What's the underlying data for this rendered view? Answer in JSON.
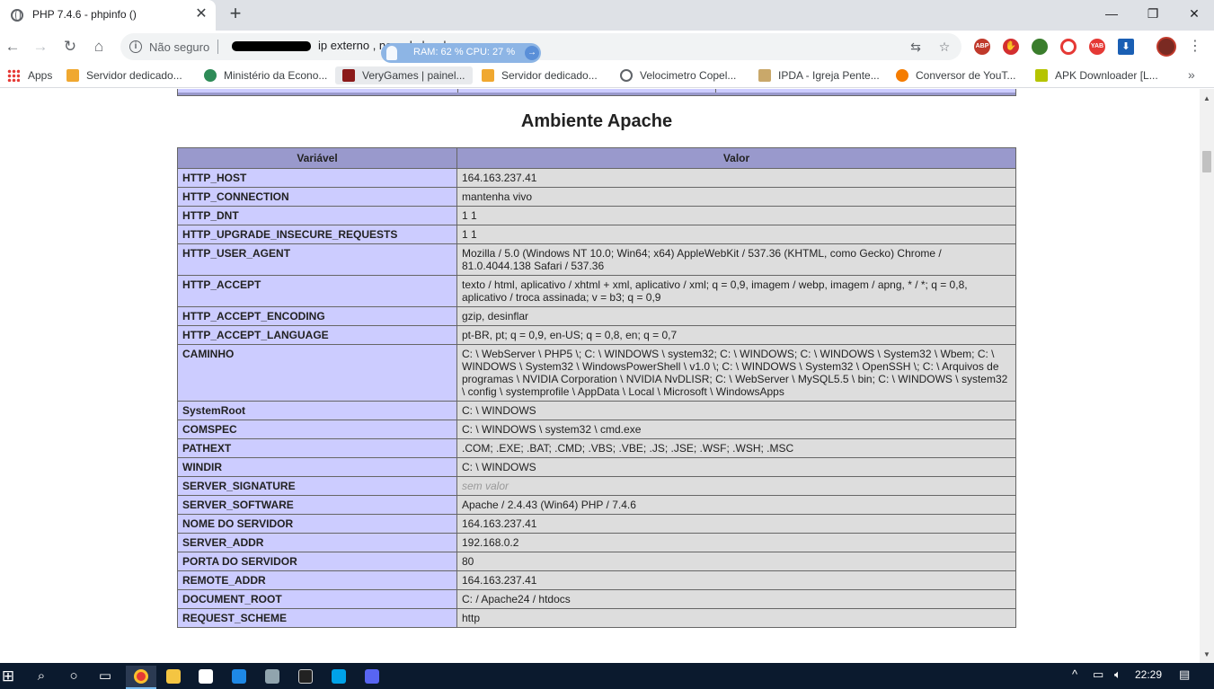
{
  "browser": {
    "tab_title": "PHP 7.4.6 - phpinfo ()",
    "tab_close": "✕",
    "new_tab": "+",
    "window_controls": {
      "minimize": "—",
      "maximize": "❐",
      "close": "✕"
    },
    "nav": {
      "back": "←",
      "forward": "→",
      "reload": "↻",
      "home": "⌂"
    },
    "omnibox": {
      "security_label": "Não seguro",
      "url_text": "ip externo , na rede local"
    },
    "ram_cpu": "RAM: 62 %  CPU: 27 %",
    "icons": {
      "translate": "translate-icon",
      "star": "star-icon",
      "ext_abp": "ABP",
      "ext_yab": "YAB",
      "menu": "⋮"
    },
    "bookmarks": [
      {
        "label": "Apps",
        "color": "#e53935",
        "icon": "apps-grid-icon"
      },
      {
        "label": "Servidor dedicado...",
        "color": "#f0a830",
        "icon": "server-icon"
      },
      {
        "label": "Ministério da Econo...",
        "color": "#2e8b57",
        "icon": "ministry-icon"
      },
      {
        "label": "VeryGames | painel...",
        "color": "#8b1a1a",
        "icon": "verygames-icon"
      },
      {
        "label": "Servidor dedicado...",
        "color": "#f0a830",
        "icon": "server-icon"
      },
      {
        "label": "Velocimetro Copel...",
        "color": "#5f6368",
        "icon": "globe-icon"
      },
      {
        "label": "IPDA - Igreja Pente...",
        "color": "#c9a86a",
        "icon": "church-icon"
      },
      {
        "label": "Conversor de YouT...",
        "color": "#f57c00",
        "icon": "converter-icon"
      },
      {
        "label": "APK Downloader [L...",
        "color": "#b5c400",
        "icon": "apk-icon"
      }
    ],
    "bookmarks_more": "»"
  },
  "page": {
    "section_title": "Ambiente Apache",
    "table_headers": {
      "variable": "Variável",
      "value": "Valor"
    },
    "rows": [
      {
        "name": "HTTP_HOST",
        "value": "164.163.237.41"
      },
      {
        "name": "HTTP_CONNECTION",
        "value": "mantenha vivo"
      },
      {
        "name": "HTTP_DNT",
        "value": "1 1"
      },
      {
        "name": "HTTP_UPGRADE_INSECURE_REQUESTS",
        "value": "1 1"
      },
      {
        "name": "HTTP_USER_AGENT",
        "value": "Mozilla / 5.0 (Windows NT 10.0; Win64; x64) AppleWebKit / 537.36 (KHTML, como Gecko) Chrome / 81.0.4044.138 Safari / 537.36"
      },
      {
        "name": "HTTP_ACCEPT",
        "value": "texto / html, aplicativo / xhtml + xml, aplicativo / xml; q = 0,9, imagem / webp, imagem / apng, * / *; q = 0,8, aplicativo / troca assinada; v = b3; q = 0,9"
      },
      {
        "name": "HTTP_ACCEPT_ENCODING",
        "value": "gzip, desinflar"
      },
      {
        "name": "HTTP_ACCEPT_LANGUAGE",
        "value": "pt-BR, pt; q = 0,9, en-US; q = 0,8, en; q = 0,7"
      },
      {
        "name": "CAMINHO",
        "value": "C: \\ WebServer \\ PHP5 \\; C: \\ WINDOWS \\ system32; C: \\ WINDOWS; C: \\ WINDOWS \\ System32 \\ Wbem; C: \\ WINDOWS \\ System32 \\ WindowsPowerShell \\ v1.0 \\; C: \\ WINDOWS \\ System32 \\ OpenSSH \\; C: \\ Arquivos de programas \\ NVIDIA Corporation \\ NVIDIA NvDLISR; C: \\ WebServer \\ MySQL5.5 \\ bin; C: \\ WINDOWS \\ system32 \\ config \\ systemprofile \\ AppData \\ Local \\ Microsoft \\ WindowsApps"
      },
      {
        "name": "SystemRoot",
        "value": "C: \\ WINDOWS"
      },
      {
        "name": "COMSPEC",
        "value": "C: \\ WINDOWS \\ system32 \\ cmd.exe"
      },
      {
        "name": "PATHEXT",
        "value": ".COM; .EXE; .BAT; .CMD; .VBS; .VBE; .JS; .JSE; .WSF; .WSH; .MSC"
      },
      {
        "name": "WINDIR",
        "value": "C: \\ WINDOWS"
      },
      {
        "name": "SERVER_SIGNATURE",
        "value": "sem valor",
        "no_value": true
      },
      {
        "name": "SERVER_SOFTWARE",
        "value": "Apache / 2.4.43 (Win64) PHP / 7.4.6"
      },
      {
        "name": "NOME DO SERVIDOR",
        "value": "164.163.237.41"
      },
      {
        "name": "SERVER_ADDR",
        "value": "192.168.0.2"
      },
      {
        "name": "PORTA DO SERVIDOR",
        "value": "80"
      },
      {
        "name": "REMOTE_ADDR",
        "value": "164.163.237.41"
      },
      {
        "name": "DOCUMENT_ROOT",
        "value": "C: / Apache24 / htdocs"
      },
      {
        "name": "REQUEST_SCHEME",
        "value": "http"
      }
    ]
  },
  "taskbar": {
    "clock": "22:29",
    "tray": {
      "chevron": "^",
      "network": "network-icon",
      "volume": "volume-icon",
      "notifications": "notification-icon"
    }
  },
  "colors": {
    "php_header": "#9999cc",
    "php_key_cell": "#ccccff",
    "php_value_cell": "#dddddd"
  }
}
